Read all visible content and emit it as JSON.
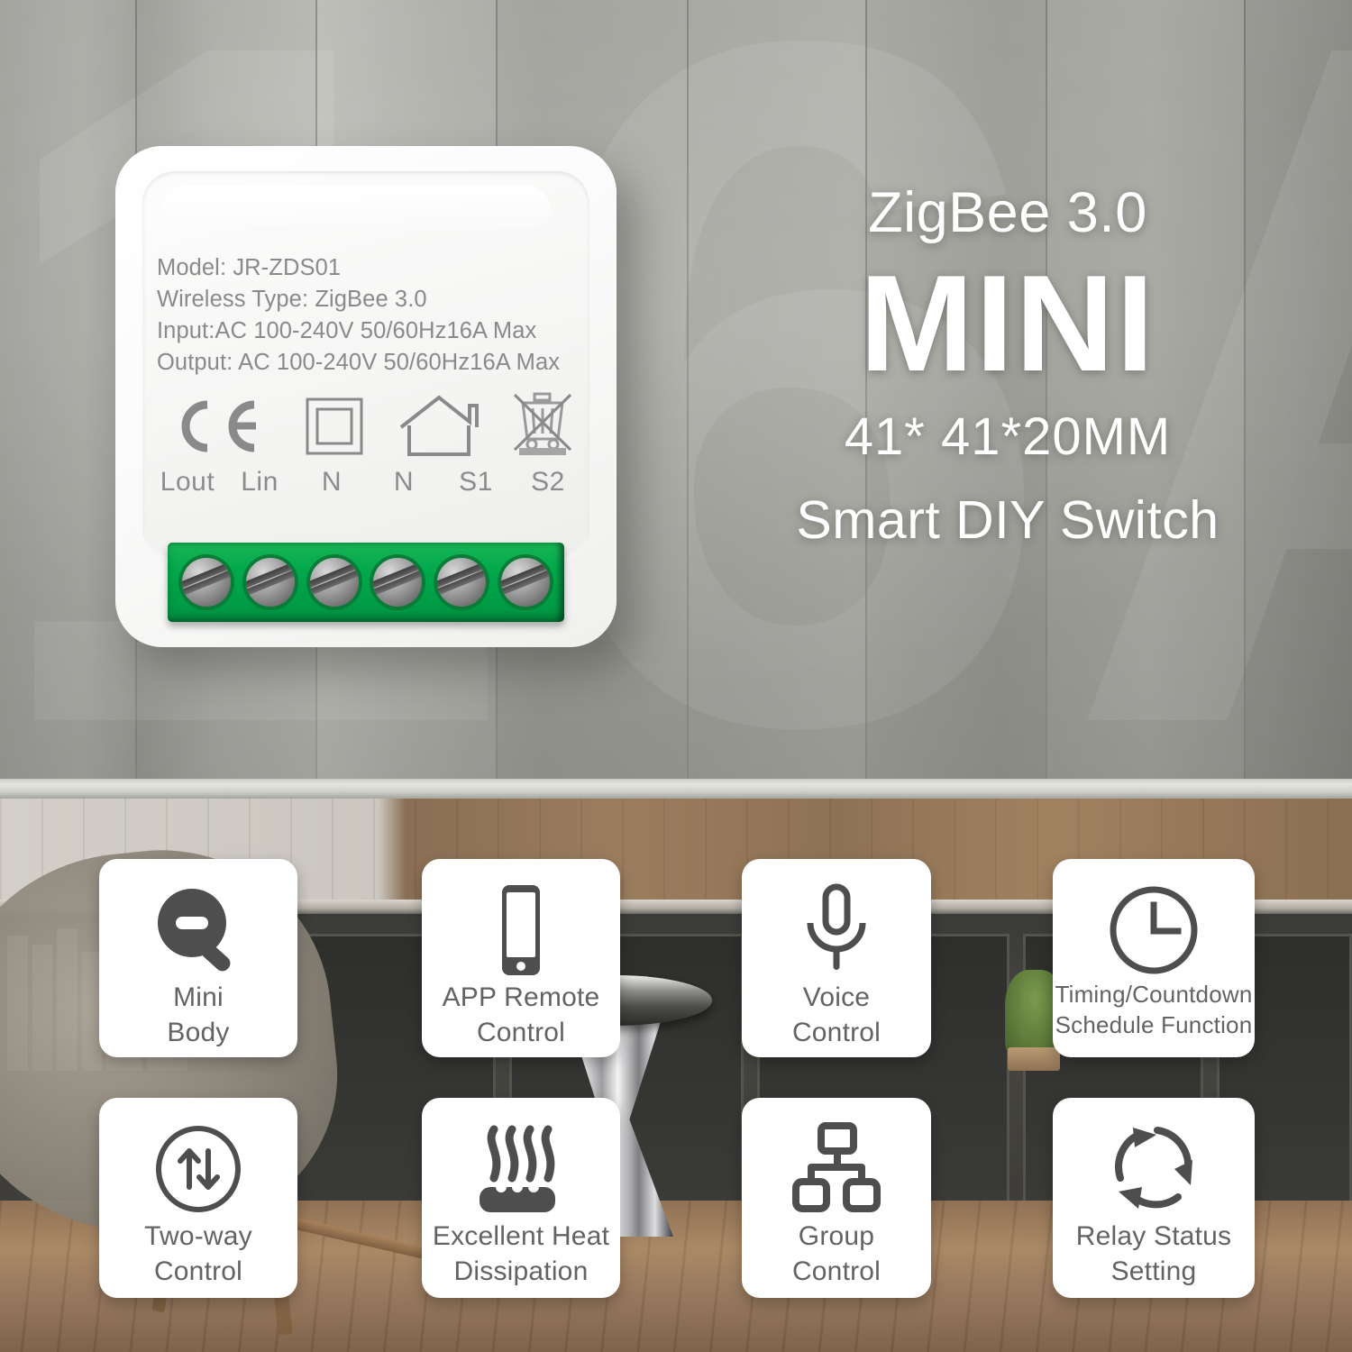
{
  "product": {
    "label_lines": [
      "Model: JR-ZDS01",
      "Wireless Type: ZigBee 3.0",
      "Input:AC 100-240V 50/60Hz16A Max",
      "Output: AC 100-240V 50/60Hz16A Max"
    ],
    "certifications": [
      {
        "name": "ce-mark-icon",
        "alt": "CE"
      },
      {
        "name": "class-two-insulation-icon",
        "alt": "Class II"
      },
      {
        "name": "indoor-use-house-icon",
        "alt": "Indoor use"
      },
      {
        "name": "weee-crossed-bin-icon",
        "alt": "WEEE"
      }
    ],
    "terminals": [
      "Lout",
      "Lin",
      "N",
      "N",
      "S1",
      "S2"
    ],
    "terminal_block_color": "#00a84b",
    "screw_count": 6
  },
  "headline": {
    "protocol": "ZigBee 3.0",
    "title": "MINI",
    "dimensions": "41* 41*20MM",
    "subtitle": "Smart DIY Switch"
  },
  "background": {
    "watermark_text": "16A",
    "upper_scene": "grey wall panels",
    "lower_scene": "living room cabinetry"
  },
  "features": [
    {
      "icon": "magnifier-minus-icon",
      "line1": "Mini",
      "line2": "Body",
      "size": "big"
    },
    {
      "icon": "smartphone-icon",
      "line1": "APP Remote",
      "line2": "Control",
      "size": "big"
    },
    {
      "icon": "microphone-icon",
      "line1": "Voice",
      "line2": "Control",
      "size": "big"
    },
    {
      "icon": "clock-icon",
      "line1": "Timing/Countdown",
      "line2": "Schedule Function",
      "size": "small"
    },
    {
      "icon": "two-way-arrows-icon",
      "line1": "Two-way",
      "line2": "Control",
      "size": "big"
    },
    {
      "icon": "heat-waves-icon",
      "line1": "Excellent Heat",
      "line2": "Dissipation",
      "size": "big"
    },
    {
      "icon": "network-hierarchy-icon",
      "line1": "Group",
      "line2": "Control",
      "size": "big"
    },
    {
      "icon": "refresh-cycle-icon",
      "line1": "Relay Status",
      "line2": "Setting",
      "size": "big"
    }
  ],
  "colors": {
    "icon_dark": "#4e4e4e",
    "label_grey": "#636363",
    "spec_grey": "#8a8a8a",
    "terminal_green": "#00a84b",
    "card_white": "#ffffff"
  }
}
